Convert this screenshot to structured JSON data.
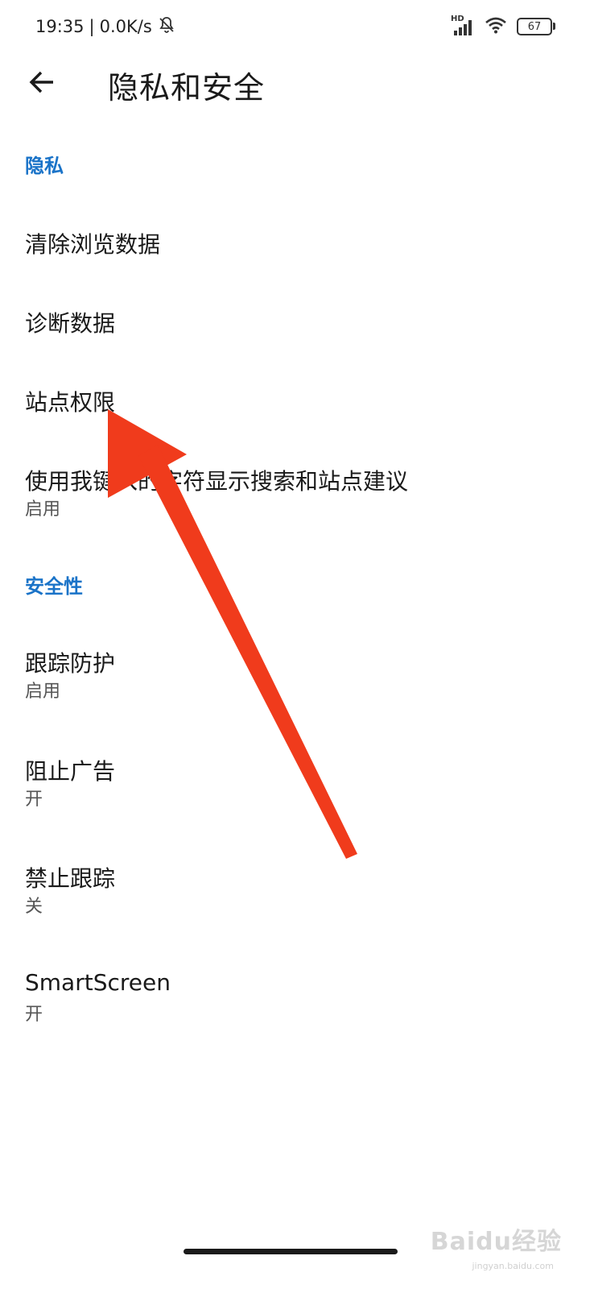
{
  "status_bar": {
    "time": "19:35",
    "separator": "|",
    "net_speed": "0.0K/s",
    "network_label": "HD",
    "battery": "67"
  },
  "header": {
    "title": "隐私和安全"
  },
  "sections": [
    {
      "header": "隐私",
      "items": [
        {
          "title": "清除浏览数据",
          "subtitle": ""
        },
        {
          "title": "诊断数据",
          "subtitle": ""
        },
        {
          "title": "站点权限",
          "subtitle": ""
        },
        {
          "title": "使用我键入的字符显示搜索和站点建议",
          "subtitle": "启用"
        }
      ]
    },
    {
      "header": "安全性",
      "items": [
        {
          "title": "跟踪防护",
          "subtitle": "启用"
        },
        {
          "title": "阻止广告",
          "subtitle": "开"
        },
        {
          "title": "禁止跟踪",
          "subtitle": "关"
        },
        {
          "title": "SmartScreen",
          "subtitle": "开"
        }
      ]
    }
  ],
  "annotation": {
    "arrow_color": "#f03b1c"
  },
  "watermark": {
    "text": "Baidu经验",
    "sub": "jingyan.baidu.com"
  }
}
